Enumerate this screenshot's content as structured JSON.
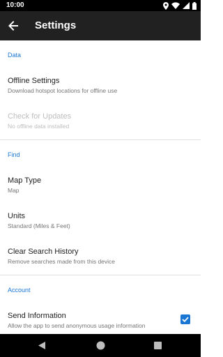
{
  "status_bar": {
    "time": "10:00"
  },
  "app_bar": {
    "title": "Settings"
  },
  "sections": {
    "data": {
      "header": "Data",
      "offline_settings": {
        "title": "Offline Settings",
        "summary": "Download hotspot locations for offline use"
      },
      "check_updates": {
        "title": "Check for Updates",
        "summary": "No offline data installed",
        "enabled": false
      }
    },
    "find": {
      "header": "Find",
      "map_type": {
        "title": "Map Type",
        "summary": "Map"
      },
      "units": {
        "title": "Units",
        "summary": "Standard (Miles & Feet)"
      },
      "clear_history": {
        "title": "Clear Search History",
        "summary": "Remove searches made from this device"
      }
    },
    "account": {
      "header": "Account",
      "send_info": {
        "title": "Send Information",
        "summary": "Allow the app to send anonymous usage information",
        "checked": true
      }
    }
  },
  "colors": {
    "accent": "#1976d2",
    "app_bar": "#212121",
    "status_bar": "#000000"
  },
  "icons": {
    "status": [
      "location-icon",
      "wifi-icon",
      "signal-icon",
      "battery-icon"
    ],
    "nav": [
      "back-triangle-icon",
      "home-circle-icon",
      "recents-square-icon"
    ]
  }
}
